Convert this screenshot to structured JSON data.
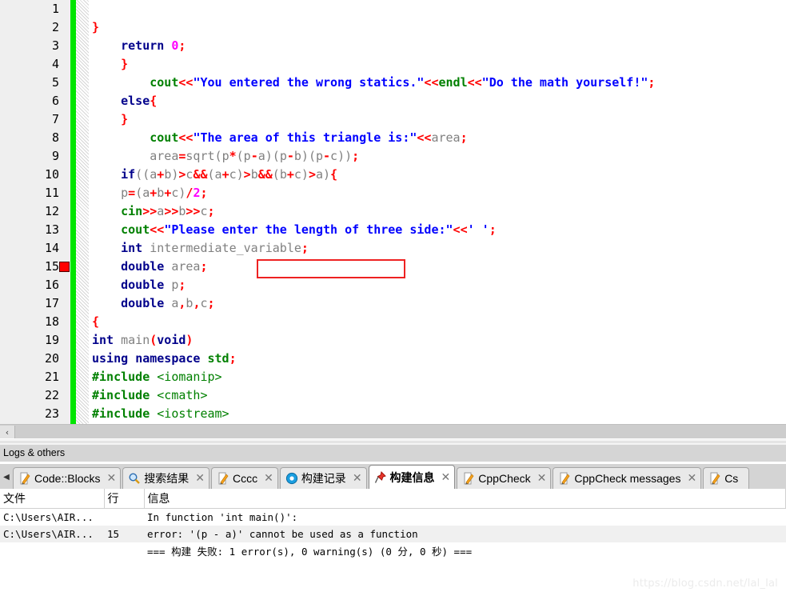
{
  "editor": {
    "total_lines": 23,
    "error_line": 15,
    "error_marker_icon": "error-square-icon",
    "annotation": {
      "type": "red-rectangle",
      "target_text": "p*(p-a)(p-b)(p-c)",
      "color": "#ee2222"
    },
    "lines": [
      {
        "n": "1",
        "tokens": [
          {
            "t": "#include ",
            "c": "pre"
          },
          {
            "t": "<iostream>",
            "c": "hdr"
          }
        ]
      },
      {
        "n": "2",
        "tokens": [
          {
            "t": "#include ",
            "c": "pre"
          },
          {
            "t": "<cmath>",
            "c": "hdr"
          }
        ]
      },
      {
        "n": "3",
        "tokens": [
          {
            "t": "#include ",
            "c": "pre"
          },
          {
            "t": "<iomanip>",
            "c": "hdr"
          }
        ]
      },
      {
        "n": "4",
        "tokens": [
          {
            "t": "using",
            "c": "kw"
          },
          {
            "t": " ",
            "c": "id"
          },
          {
            "t": "namespace",
            "c": "kw"
          },
          {
            "t": " ",
            "c": "id"
          },
          {
            "t": "std",
            "c": "fn"
          },
          {
            "t": ";",
            "c": "op"
          }
        ]
      },
      {
        "n": "5",
        "tokens": [
          {
            "t": "int",
            "c": "kw"
          },
          {
            "t": " ",
            "c": "id"
          },
          {
            "t": "main",
            "c": "id"
          },
          {
            "t": "(",
            "c": "op"
          },
          {
            "t": "void",
            "c": "kw"
          },
          {
            "t": ")",
            "c": "op"
          }
        ]
      },
      {
        "n": "6",
        "tokens": [
          {
            "t": "{",
            "c": "op"
          }
        ]
      },
      {
        "n": "7",
        "tokens": [
          {
            "t": "    ",
            "c": "id"
          },
          {
            "t": "double",
            "c": "kw"
          },
          {
            "t": " ",
            "c": "id"
          },
          {
            "t": "a",
            "c": "id"
          },
          {
            "t": ",",
            "c": "op"
          },
          {
            "t": "b",
            "c": "id"
          },
          {
            "t": ",",
            "c": "op"
          },
          {
            "t": "c",
            "c": "id"
          },
          {
            "t": ";",
            "c": "op"
          }
        ]
      },
      {
        "n": "8",
        "tokens": [
          {
            "t": "    ",
            "c": "id"
          },
          {
            "t": "double",
            "c": "kw"
          },
          {
            "t": " ",
            "c": "id"
          },
          {
            "t": "p",
            "c": "id"
          },
          {
            "t": ";",
            "c": "op"
          }
        ]
      },
      {
        "n": "9",
        "tokens": [
          {
            "t": "    ",
            "c": "id"
          },
          {
            "t": "double",
            "c": "kw"
          },
          {
            "t": " ",
            "c": "id"
          },
          {
            "t": "area",
            "c": "id"
          },
          {
            "t": ";",
            "c": "op"
          }
        ]
      },
      {
        "n": "10",
        "tokens": [
          {
            "t": "    ",
            "c": "id"
          },
          {
            "t": "int",
            "c": "kw"
          },
          {
            "t": " ",
            "c": "id"
          },
          {
            "t": "intermediate_variable",
            "c": "id"
          },
          {
            "t": ";",
            "c": "op"
          }
        ]
      },
      {
        "n": "11",
        "tokens": [
          {
            "t": "    ",
            "c": "id"
          },
          {
            "t": "cout",
            "c": "fn"
          },
          {
            "t": "<<",
            "c": "op"
          },
          {
            "t": "\"Please enter the length of three side:\"",
            "c": "str"
          },
          {
            "t": "<<",
            "c": "op"
          },
          {
            "t": "' '",
            "c": "str"
          },
          {
            "t": ";",
            "c": "op"
          }
        ]
      },
      {
        "n": "12",
        "tokens": [
          {
            "t": "    ",
            "c": "id"
          },
          {
            "t": "cin",
            "c": "fn"
          },
          {
            "t": ">>",
            "c": "op"
          },
          {
            "t": "a",
            "c": "id"
          },
          {
            "t": ">>",
            "c": "op"
          },
          {
            "t": "b",
            "c": "id"
          },
          {
            "t": ">>",
            "c": "op"
          },
          {
            "t": "c",
            "c": "id"
          },
          {
            "t": ";",
            "c": "op"
          }
        ]
      },
      {
        "n": "13",
        "tokens": [
          {
            "t": "    ",
            "c": "id"
          },
          {
            "t": "p",
            "c": "id"
          },
          {
            "t": "=",
            "c": "op"
          },
          {
            "t": "(",
            "c": "par"
          },
          {
            "t": "a",
            "c": "id"
          },
          {
            "t": "+",
            "c": "op"
          },
          {
            "t": "b",
            "c": "id"
          },
          {
            "t": "+",
            "c": "op"
          },
          {
            "t": "c",
            "c": "id"
          },
          {
            "t": ")",
            "c": "par"
          },
          {
            "t": "/",
            "c": "op"
          },
          {
            "t": "2",
            "c": "num"
          },
          {
            "t": ";",
            "c": "op"
          }
        ]
      },
      {
        "n": "14",
        "tokens": [
          {
            "t": "    ",
            "c": "id"
          },
          {
            "t": "if",
            "c": "kw"
          },
          {
            "t": "(",
            "c": "par"
          },
          {
            "t": "(",
            "c": "par"
          },
          {
            "t": "a",
            "c": "id"
          },
          {
            "t": "+",
            "c": "op"
          },
          {
            "t": "b",
            "c": "id"
          },
          {
            "t": ")",
            "c": "par"
          },
          {
            "t": ">",
            "c": "op"
          },
          {
            "t": "c",
            "c": "id"
          },
          {
            "t": "&&",
            "c": "op"
          },
          {
            "t": "(",
            "c": "par"
          },
          {
            "t": "a",
            "c": "id"
          },
          {
            "t": "+",
            "c": "op"
          },
          {
            "t": "c",
            "c": "id"
          },
          {
            "t": ")",
            "c": "par"
          },
          {
            "t": ">",
            "c": "op"
          },
          {
            "t": "b",
            "c": "id"
          },
          {
            "t": "&&",
            "c": "op"
          },
          {
            "t": "(",
            "c": "par"
          },
          {
            "t": "b",
            "c": "id"
          },
          {
            "t": "+",
            "c": "op"
          },
          {
            "t": "c",
            "c": "id"
          },
          {
            "t": ")",
            "c": "par"
          },
          {
            "t": ">",
            "c": "op"
          },
          {
            "t": "a",
            "c": "id"
          },
          {
            "t": ")",
            "c": "par"
          },
          {
            "t": "{",
            "c": "op"
          }
        ]
      },
      {
        "n": "15",
        "tokens": [
          {
            "t": "        ",
            "c": "id"
          },
          {
            "t": "area",
            "c": "id"
          },
          {
            "t": "=",
            "c": "op"
          },
          {
            "t": "sqrt",
            "c": "id"
          },
          {
            "t": "(",
            "c": "par"
          },
          {
            "t": "p",
            "c": "id"
          },
          {
            "t": "*",
            "c": "op"
          },
          {
            "t": "(",
            "c": "par"
          },
          {
            "t": "p",
            "c": "id"
          },
          {
            "t": "-",
            "c": "op"
          },
          {
            "t": "a",
            "c": "id"
          },
          {
            "t": ")",
            "c": "par"
          },
          {
            "t": "(",
            "c": "par"
          },
          {
            "t": "p",
            "c": "id"
          },
          {
            "t": "-",
            "c": "op"
          },
          {
            "t": "b",
            "c": "id"
          },
          {
            "t": ")",
            "c": "par"
          },
          {
            "t": "(",
            "c": "par"
          },
          {
            "t": "p",
            "c": "id"
          },
          {
            "t": "-",
            "c": "op"
          },
          {
            "t": "c",
            "c": "id"
          },
          {
            "t": ")",
            "c": "par"
          },
          {
            "t": ")",
            "c": "par"
          },
          {
            "t": ";",
            "c": "op"
          }
        ]
      },
      {
        "n": "16",
        "tokens": [
          {
            "t": "        ",
            "c": "id"
          },
          {
            "t": "cout",
            "c": "fn"
          },
          {
            "t": "<<",
            "c": "op"
          },
          {
            "t": "\"The area of this triangle is:\"",
            "c": "str"
          },
          {
            "t": "<<",
            "c": "op"
          },
          {
            "t": "area",
            "c": "id"
          },
          {
            "t": ";",
            "c": "op"
          }
        ]
      },
      {
        "n": "17",
        "tokens": [
          {
            "t": "    ",
            "c": "id"
          },
          {
            "t": "}",
            "c": "op"
          }
        ]
      },
      {
        "n": "18",
        "tokens": [
          {
            "t": "    ",
            "c": "id"
          },
          {
            "t": "else",
            "c": "kw"
          },
          {
            "t": "{",
            "c": "op"
          }
        ]
      },
      {
        "n": "19",
        "tokens": [
          {
            "t": "        ",
            "c": "id"
          },
          {
            "t": "cout",
            "c": "fn"
          },
          {
            "t": "<<",
            "c": "op"
          },
          {
            "t": "\"You entered the wrong statics.\"",
            "c": "str"
          },
          {
            "t": "<<",
            "c": "op"
          },
          {
            "t": "endl",
            "c": "fn"
          },
          {
            "t": "<<",
            "c": "op"
          },
          {
            "t": "\"Do the math yourself!\"",
            "c": "str"
          },
          {
            "t": ";",
            "c": "op"
          }
        ]
      },
      {
        "n": "20",
        "tokens": [
          {
            "t": "    ",
            "c": "id"
          },
          {
            "t": "}",
            "c": "op"
          }
        ]
      },
      {
        "n": "21",
        "tokens": [
          {
            "t": "    ",
            "c": "id"
          },
          {
            "t": "return",
            "c": "kw"
          },
          {
            "t": " ",
            "c": "id"
          },
          {
            "t": "0",
            "c": "num"
          },
          {
            "t": ";",
            "c": "op"
          }
        ]
      },
      {
        "n": "22",
        "tokens": [
          {
            "t": "}",
            "c": "op"
          }
        ]
      },
      {
        "n": "23",
        "tokens": []
      }
    ]
  },
  "hscroll": {
    "left_arrow": "‹"
  },
  "logs_panel": {
    "title": "Logs & others",
    "tab_scroll_left": "◀",
    "tabs": [
      {
        "label": "Code::Blocks",
        "icon": "notepad-pencil-icon",
        "active": false,
        "close": "✕"
      },
      {
        "label": "搜索结果",
        "icon": "magnifier-icon",
        "active": false,
        "close": "✕"
      },
      {
        "label": "Cccc",
        "icon": "notepad-pencil-icon",
        "active": false,
        "close": "✕"
      },
      {
        "label": "构建记录",
        "icon": "gear-blue-icon",
        "active": false,
        "close": "✕"
      },
      {
        "label": "构建信息",
        "icon": "pushpin-icon",
        "active": true,
        "close": "✕"
      },
      {
        "label": "CppCheck",
        "icon": "notepad-pencil-icon",
        "active": false,
        "close": "✕"
      },
      {
        "label": "CppCheck messages",
        "icon": "notepad-pencil-icon",
        "active": false,
        "close": "✕"
      },
      {
        "label": "Cs",
        "icon": "notepad-pencil-icon",
        "active": false,
        "close": ""
      }
    ]
  },
  "build_messages": {
    "columns": [
      "文件",
      "行",
      "信息"
    ],
    "rows": [
      {
        "file": "C:\\Users\\AIR...",
        "line": "",
        "message": "In function 'int main()':"
      },
      {
        "file": "C:\\Users\\AIR...",
        "line": "15",
        "message": "error: '(p - a)' cannot be used as a function"
      },
      {
        "file": "",
        "line": "",
        "message": "=== 构建 失败: 1 error(s), 0 warning(s) (0 分, 0 秒) ==="
      }
    ]
  },
  "watermark": {
    "text": "https://blog.csdn.net/lal_lal"
  }
}
